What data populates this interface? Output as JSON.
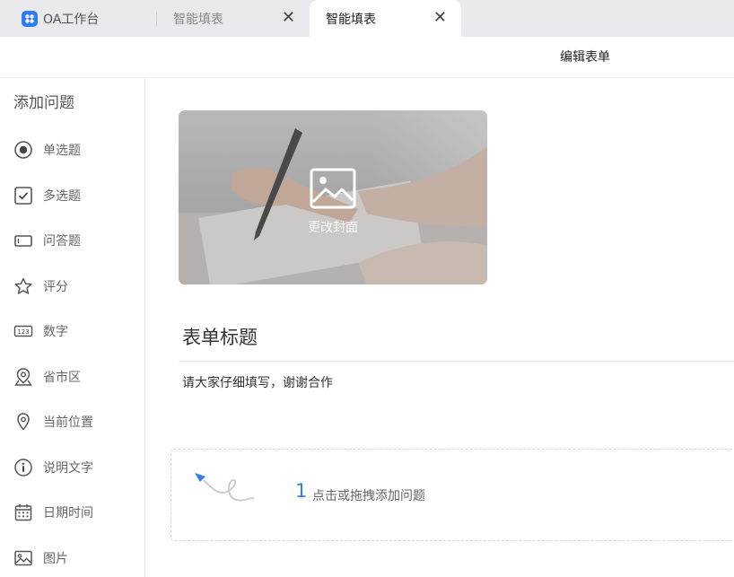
{
  "tabs": [
    {
      "label": "OA工作台",
      "icon": "app-logo-icon"
    },
    {
      "label": "智能填表",
      "close": "✕"
    },
    {
      "label": "智能填表",
      "close": "✕",
      "active": true
    }
  ],
  "header": {
    "title": "编辑表单"
  },
  "sidebar": {
    "heading": "添加问题",
    "items": [
      {
        "label": "单选题",
        "icon": "radio-icon"
      },
      {
        "label": "多选题",
        "icon": "checkbox-icon"
      },
      {
        "label": "问答题",
        "icon": "text-box-icon"
      },
      {
        "label": "评分",
        "icon": "star-icon"
      },
      {
        "label": "数字",
        "icon": "number-icon",
        "icon_text": "123"
      },
      {
        "label": "省市区",
        "icon": "map-region-icon"
      },
      {
        "label": "当前位置",
        "icon": "location-pin-icon"
      },
      {
        "label": "说明文字",
        "icon": "info-icon"
      },
      {
        "label": "日期时间",
        "icon": "calendar-icon"
      },
      {
        "label": "图片",
        "icon": "image-icon"
      }
    ]
  },
  "main": {
    "cover_label": "更改封面",
    "form_title": "表单标题",
    "form_desc": "请大家仔细填写，谢谢合作",
    "drop_number": "1",
    "drop_text": "点击或拖拽添加问题"
  },
  "colors": {
    "accent": "#2f7cf6",
    "tabbar_bg": "#e9eaee",
    "icon_gray": "#555555"
  }
}
